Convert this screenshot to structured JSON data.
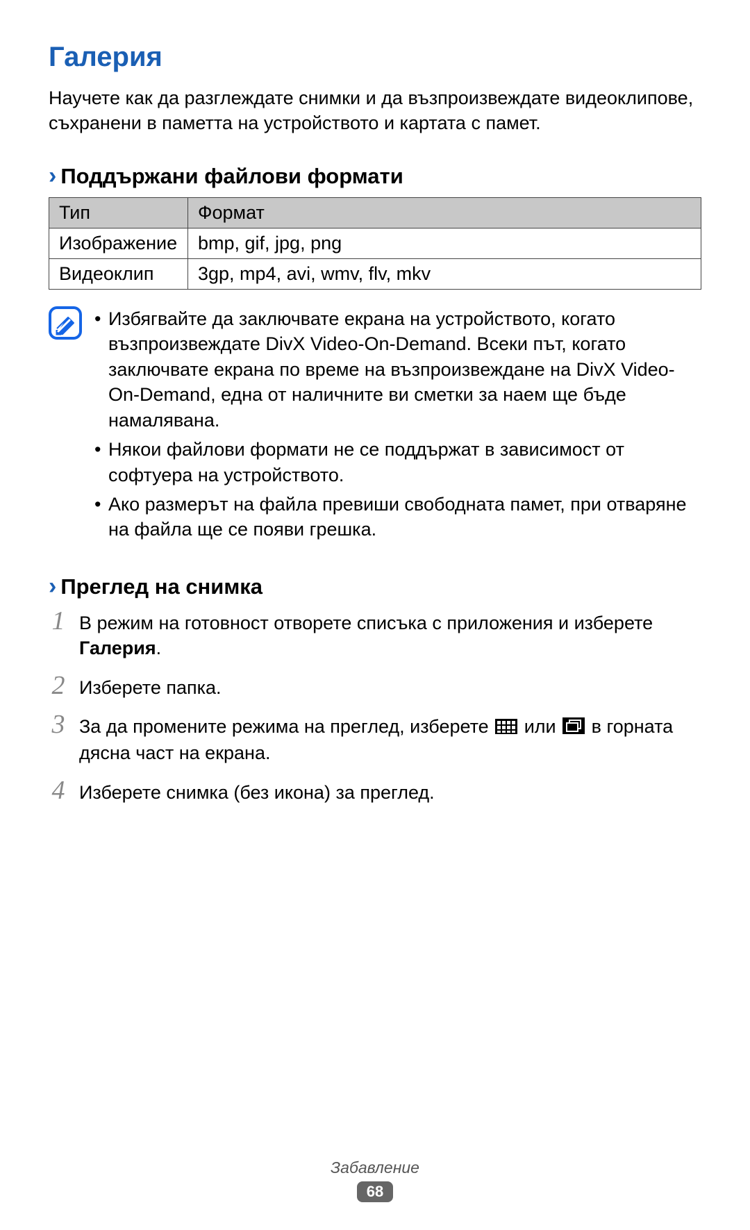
{
  "title": "Галерия",
  "intro": "Научете как да разглеждате снимки и да възпроизвеждате видеоклипове, съхранени в паметта на устройството и картата с памет.",
  "subsection1_heading": "Поддържани файлови формати",
  "table": {
    "header_col1": "Тип",
    "header_col2": "Формат",
    "rows": [
      {
        "c1": "Изображение",
        "c2": "bmp, gif, jpg, png"
      },
      {
        "c1": "Видеоклип",
        "c2": "3gp, mp4, avi, wmv, flv, mkv"
      }
    ]
  },
  "notes": [
    "Избягвайте да заключвате екрана на устройството, когато възпроизвеждате DivX Video-On-Demand. Всеки път, когато заключвате екрана по време на възпроизвеждане на DivX Video-On-Demand, една от наличните ви сметки за наем ще бъде намалявана.",
    "Някои файлови формати не се поддържат в зависимост от софтуера на устройството.",
    "Ако размерът на файла превиши свободната памет, при отваряне на файла ще се появи грешка."
  ],
  "subsection2_heading": "Преглед на снимка",
  "steps": {
    "s1_pre": "В режим на готовност отворете списъка с приложения и изберете ",
    "s1_bold": "Галерия",
    "s1_post": ".",
    "s2": "Изберете папка.",
    "s3_pre": "За да промените режима на преглед, изберете ",
    "s3_mid": " или ",
    "s3_post": " в горната дясна част на екрана.",
    "s4": "Изберете снимка (без икона) за преглед."
  },
  "footer_section": "Забавление",
  "footer_page": "68"
}
